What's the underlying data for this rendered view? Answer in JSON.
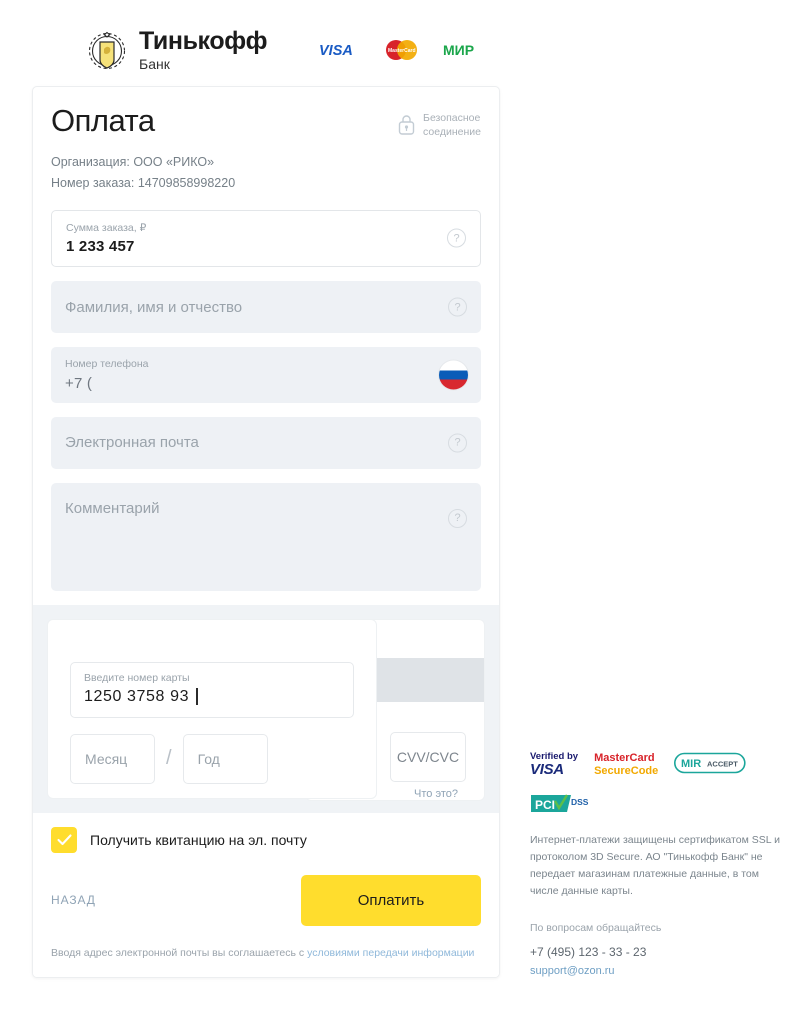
{
  "brand": {
    "name": "Тинькофф",
    "sub": "Банк",
    "logo_icon": "tinkoff-crest-icon",
    "payment_logos": [
      {
        "name": "visa-logo",
        "label": "VISA"
      },
      {
        "name": "mastercard-logo",
        "label": "MasterCard"
      },
      {
        "name": "mir-logo",
        "label": "МИР"
      }
    ]
  },
  "form": {
    "title": "Оплата",
    "secure": {
      "icon": "lock-icon",
      "line1": "Безопасное",
      "line2": "соединение"
    },
    "organization": "Организация: ООО «РИКО»",
    "order_number": "Номер заказа: 14709858998220",
    "fields": {
      "amount": {
        "label": "Сумма заказа, ₽",
        "value": "1 233 457",
        "help": "?"
      },
      "fio": {
        "placeholder": "Фамилия, имя и отчество",
        "help": "?"
      },
      "phone": {
        "label": "Номер телефона",
        "value": "+7 (",
        "flag": "ru-flag-icon"
      },
      "email": {
        "placeholder": "Электронная почта",
        "help": "?"
      },
      "comment": {
        "placeholder": "Комментарий",
        "help": "?"
      }
    }
  },
  "card": {
    "number_label": "Введите номер карты",
    "number_value": "1250 3758 93",
    "month_placeholder": "Месяц",
    "separator": "/",
    "year_placeholder": "Год",
    "cvv_placeholder": "CVV/CVC",
    "what_is_link": "Что это?"
  },
  "footer": {
    "receipt_checkbox_label": "Получить квитанцию на эл. почту",
    "receipt_checked": true,
    "back_label": "НАЗАД",
    "pay_label": "Оплатить",
    "agreement_prefix": "Вводя адрес электронной почты вы соглашаетесь с ",
    "agreement_link": "условиями передачи информации"
  },
  "sidebar": {
    "badges": [
      {
        "name": "verified-by-visa-badge",
        "line1": "Verified by",
        "line2": "VISA"
      },
      {
        "name": "mastercard-securecode-badge",
        "line1": "MasterCard",
        "line2": "SecureCode"
      },
      {
        "name": "mir-accept-badge",
        "line1": "MIR",
        "line2": "ACCEPT"
      },
      {
        "name": "pci-dss-badge",
        "line1": "PCI",
        "line2": "DSS"
      }
    ],
    "info_text": "Интернет-платежи защищены сертификатом SSL и протоколом 3D Secure. АО \"Тинькофф Банк\" не передает магазинам платежные данные, в том числе данные карты.",
    "contact_heading": "По вопросам обращайтесь",
    "contact_phone": "+7 (495) 123 - 33 - 23",
    "contact_email": "support@ozon.ru"
  },
  "colors": {
    "accent_yellow": "#FFDD2D",
    "field_bg": "#EEF1F5",
    "link_blue": "#8FB8DA",
    "text_dark": "#1C1C1C",
    "text_muted": "#9AA3AB"
  }
}
